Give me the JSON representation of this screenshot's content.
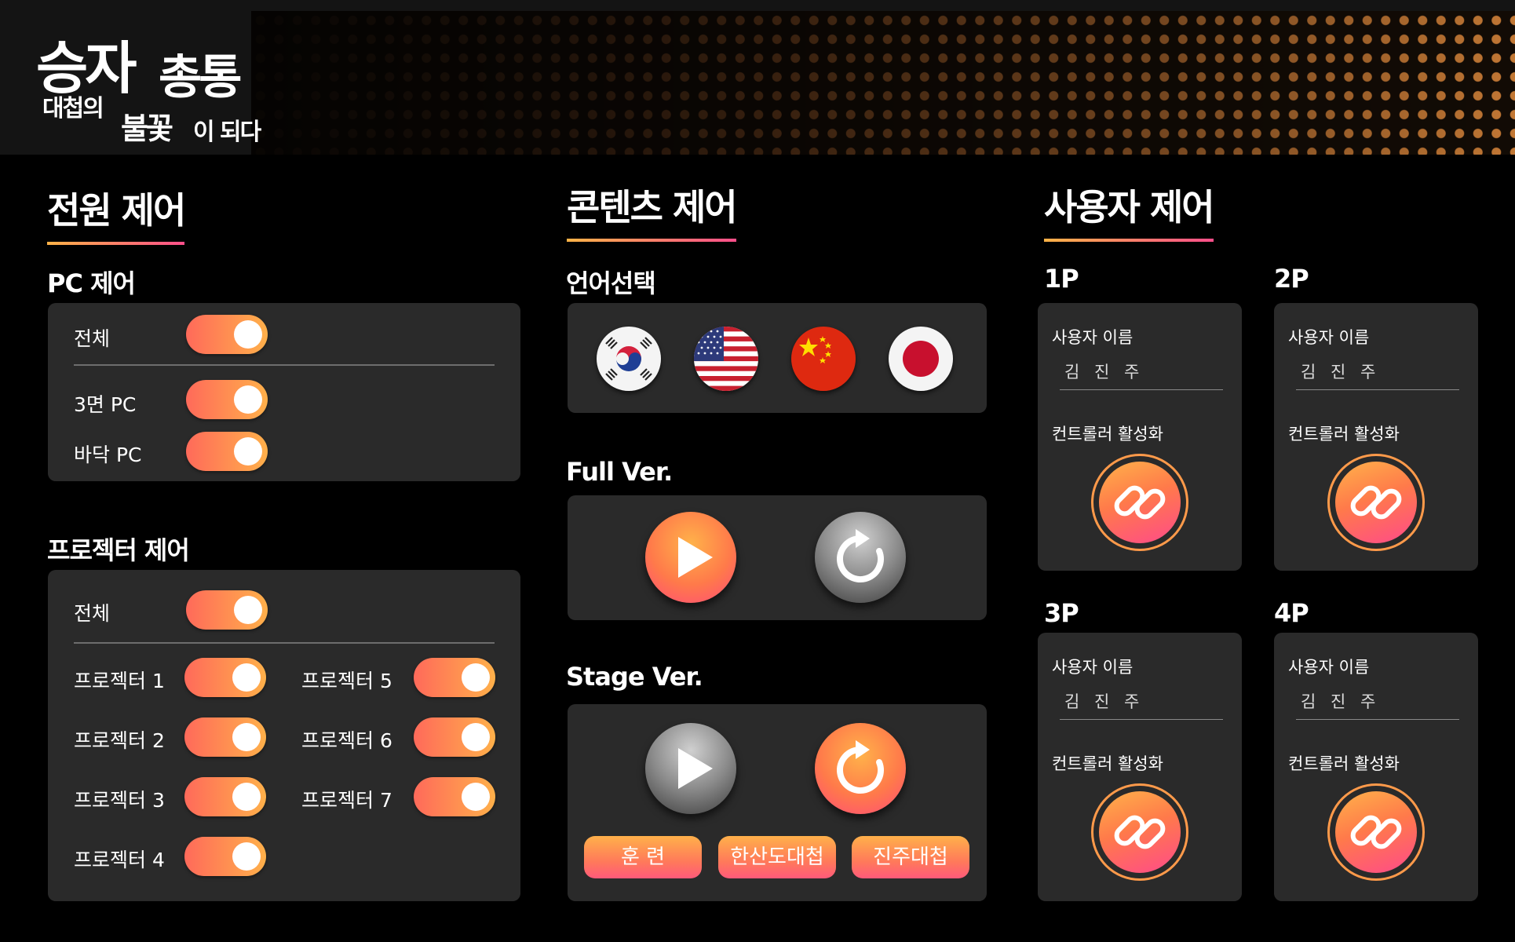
{
  "header": {
    "logo": {
      "line1_a": "승자",
      "line1_b": "총통",
      "line2_a": "대첩의",
      "line2_b": "불꽃",
      "line2_c": "이 되다"
    }
  },
  "power": {
    "title": "전원 제어",
    "pc": {
      "title": "PC 제어",
      "all_label": "전체",
      "items": [
        {
          "label": "3면 PC",
          "on": true
        },
        {
          "label": "바닥 PC",
          "on": true
        }
      ],
      "all_on": true
    },
    "projector": {
      "title": "프로젝터 제어",
      "all_label": "전체",
      "all_on": true,
      "items": [
        {
          "label": "프로젝터 1",
          "on": true
        },
        {
          "label": "프로젝터 2",
          "on": true
        },
        {
          "label": "프로젝터 3",
          "on": true
        },
        {
          "label": "프로젝터 4",
          "on": true
        },
        {
          "label": "프로젝터 5",
          "on": true
        },
        {
          "label": "프로젝터 6",
          "on": true
        },
        {
          "label": "프로젝터 7",
          "on": true
        }
      ]
    }
  },
  "content": {
    "title": "콘텐츠 제어",
    "language": {
      "title": "언어선택",
      "flags": [
        "korea-flag-icon",
        "usa-flag-icon",
        "china-flag-icon",
        "japan-flag-icon"
      ]
    },
    "full_ver": {
      "title": "Full Ver.",
      "play_icon": "play-icon",
      "replay_icon": "replay-icon"
    },
    "stage_ver": {
      "title": "Stage Ver.",
      "play_icon": "play-icon",
      "replay_icon": "replay-icon",
      "buttons": [
        "훈 련",
        "한산도대첩",
        "진주대첩"
      ]
    }
  },
  "users": {
    "title": "사용자 제어",
    "players": [
      {
        "id": "1P",
        "name_label": "사용자 이름",
        "name": "김 진 주",
        "controller_label": "컨트롤러 활성화"
      },
      {
        "id": "2P",
        "name_label": "사용자 이름",
        "name": "김 진 주",
        "controller_label": "컨트롤러 활성화"
      },
      {
        "id": "3P",
        "name_label": "사용자 이름",
        "name": "김 진 주",
        "controller_label": "컨트롤러 활성화"
      },
      {
        "id": "4P",
        "name_label": "사용자 이름",
        "name": "김 진 주",
        "controller_label": "컨트롤러 활성화"
      }
    ]
  },
  "colors": {
    "accent_start": "#ffb04a",
    "accent_end": "#ff4f8b",
    "panel": "#2a2a2a",
    "background": "#000000"
  }
}
